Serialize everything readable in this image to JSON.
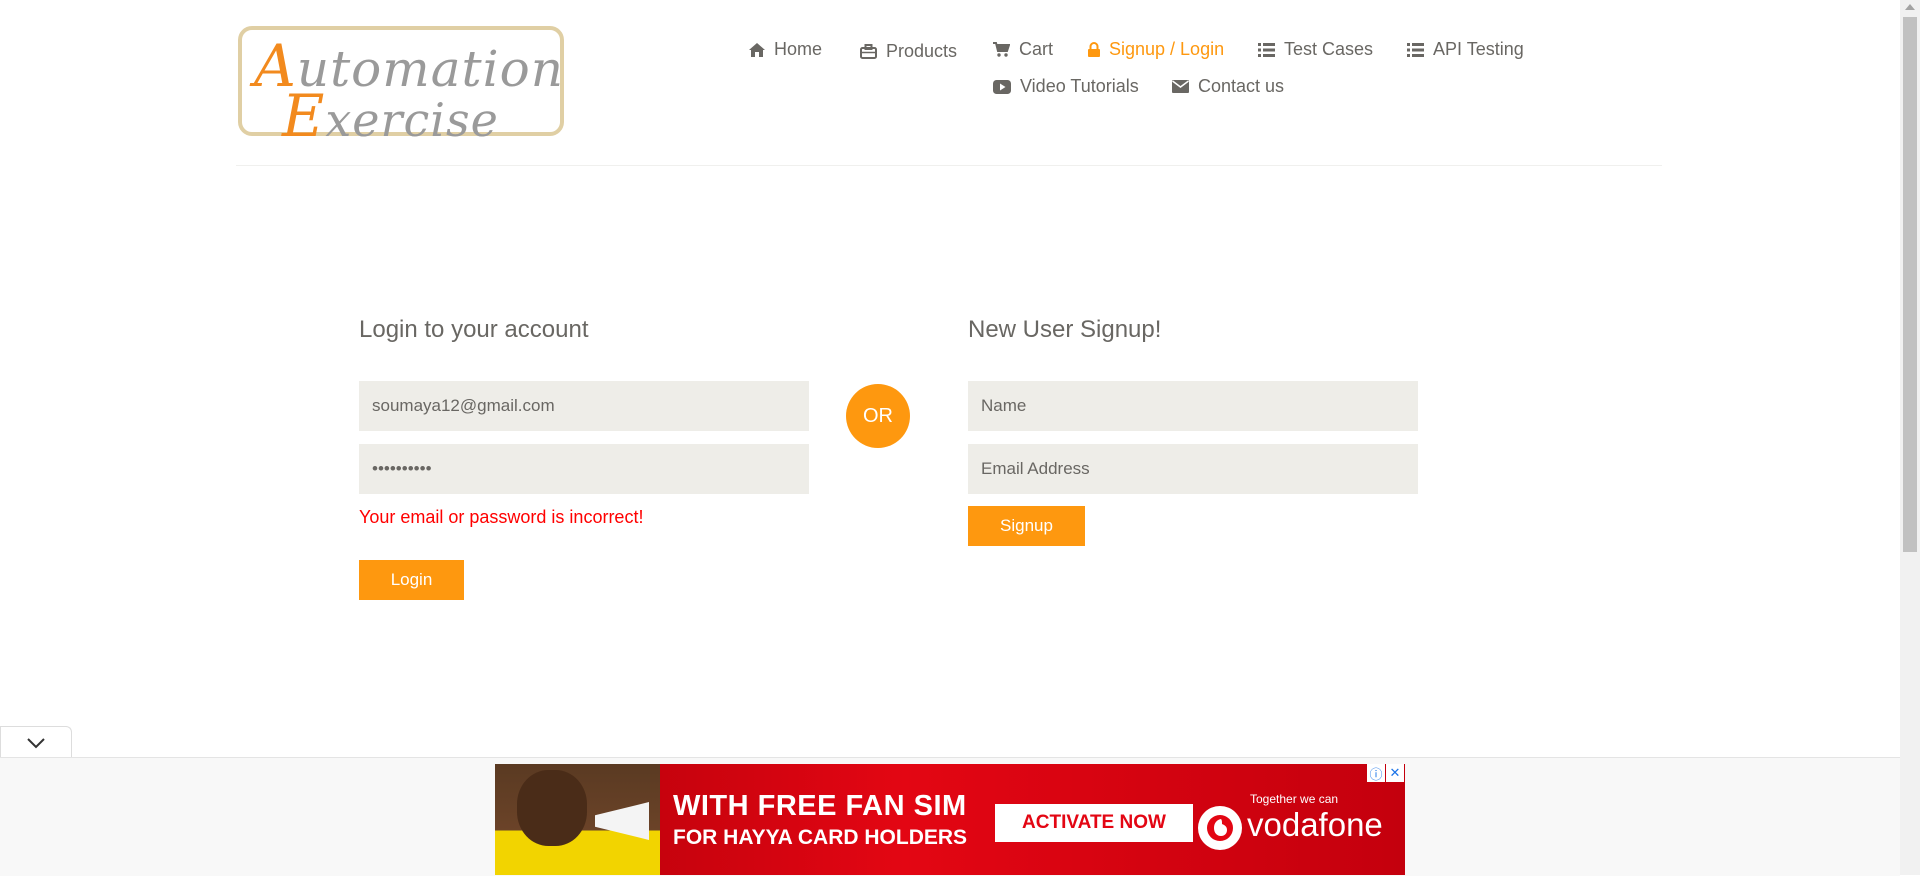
{
  "logo": {
    "line1_cap": "A",
    "line1_rest": "utomation",
    "line2_cap": "E",
    "line2_rest": "xercise"
  },
  "nav": [
    {
      "label": "Home",
      "icon": "home-icon",
      "active": false
    },
    {
      "label": "Products",
      "icon": "briefcase-icon",
      "active": false
    },
    {
      "label": "Cart",
      "icon": "cart-icon",
      "active": false
    },
    {
      "label": "Signup / Login",
      "icon": "lock-icon",
      "active": true
    },
    {
      "label": "Test Cases",
      "icon": "list-icon",
      "active": false
    },
    {
      "label": "API Testing",
      "icon": "list-icon",
      "active": false
    },
    {
      "label": "Video Tutorials",
      "icon": "youtube-play-icon",
      "active": false
    },
    {
      "label": "Contact us",
      "icon": "envelope-icon",
      "active": false
    }
  ],
  "login": {
    "title": "Login to your account",
    "email_value": "soumaya12@gmail.com",
    "password_value": "••••••••••",
    "error": "Your email or password is incorrect!",
    "button": "Login"
  },
  "or_label": "OR",
  "signup": {
    "title": "New User Signup!",
    "name_placeholder": "Name",
    "email_placeholder": "Email Address",
    "button": "Signup"
  },
  "ad": {
    "headline": "WITH FREE FAN SIM",
    "subline": "FOR HAYYA CARD HOLDERS",
    "cta": "ACTIVATE NOW",
    "tagline": "Together we can",
    "brand": "vodafone",
    "info_glyph": "ⓘ",
    "close_glyph": "✕"
  },
  "colors": {
    "accent": "#FE980F",
    "error": "#ff0000",
    "text": "#696763",
    "field_bg": "#eeede8"
  }
}
